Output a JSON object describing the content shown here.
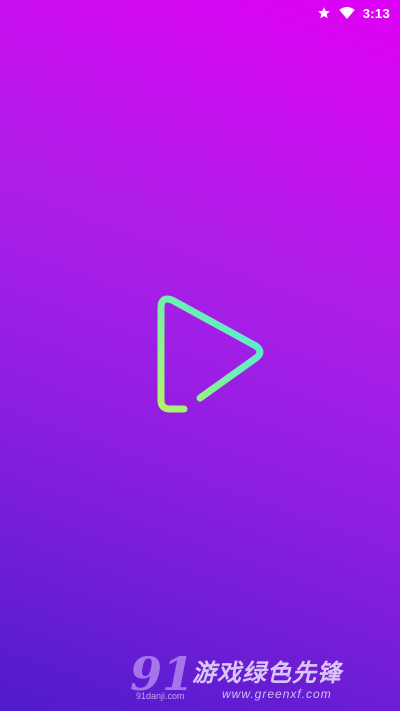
{
  "status_bar": {
    "time": "3:13",
    "icons": [
      "star-icon",
      "wifi-icon"
    ]
  },
  "splash": {
    "logo_icon": "play-triangle-logo-icon"
  },
  "watermark": {
    "number": "91",
    "subtext": "91danji.com",
    "chinese_text": "游戏绿色先锋",
    "url": "www.greenxf.com"
  },
  "colors": {
    "gradient_top": "#e000f4",
    "gradient_bottom": "#4f1ccc",
    "logo_green": "#a8f070",
    "logo_cyan": "#5ce8e0",
    "status_text": "#ffffff"
  }
}
